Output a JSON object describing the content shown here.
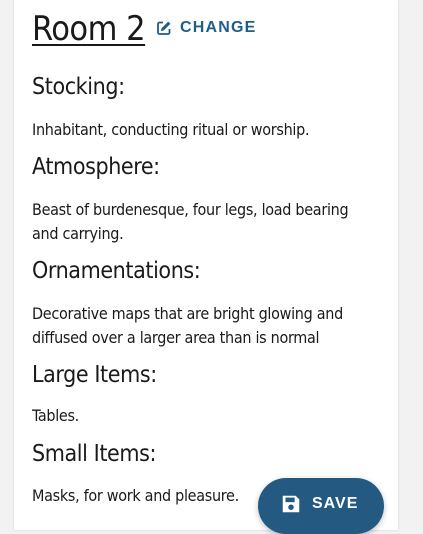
{
  "room": {
    "title": "Room 2",
    "change_label": "CHANGE"
  },
  "sections": [
    {
      "title": "Stocking:",
      "text": "Inhabitant, conducting ritual or worship."
    },
    {
      "title": "Atmosphere:",
      "text": "Beast of burdenesque, four legs, load bearing and carrying."
    },
    {
      "title": "Ornamentations:",
      "text": "Decorative maps that are bright glowing  and diffused over a larger area than is normal"
    },
    {
      "title": "Large Items:",
      "text": "Tables."
    },
    {
      "title": "Small Items:",
      "text": "Masks, for work and pleasure."
    }
  ],
  "fab": {
    "save_label": "SAVE",
    "icon": "floppy-disk-icon"
  },
  "colors": {
    "accent": "#1f5d8c",
    "fab_background": "#245a82",
    "text": "#1a1a1a"
  }
}
